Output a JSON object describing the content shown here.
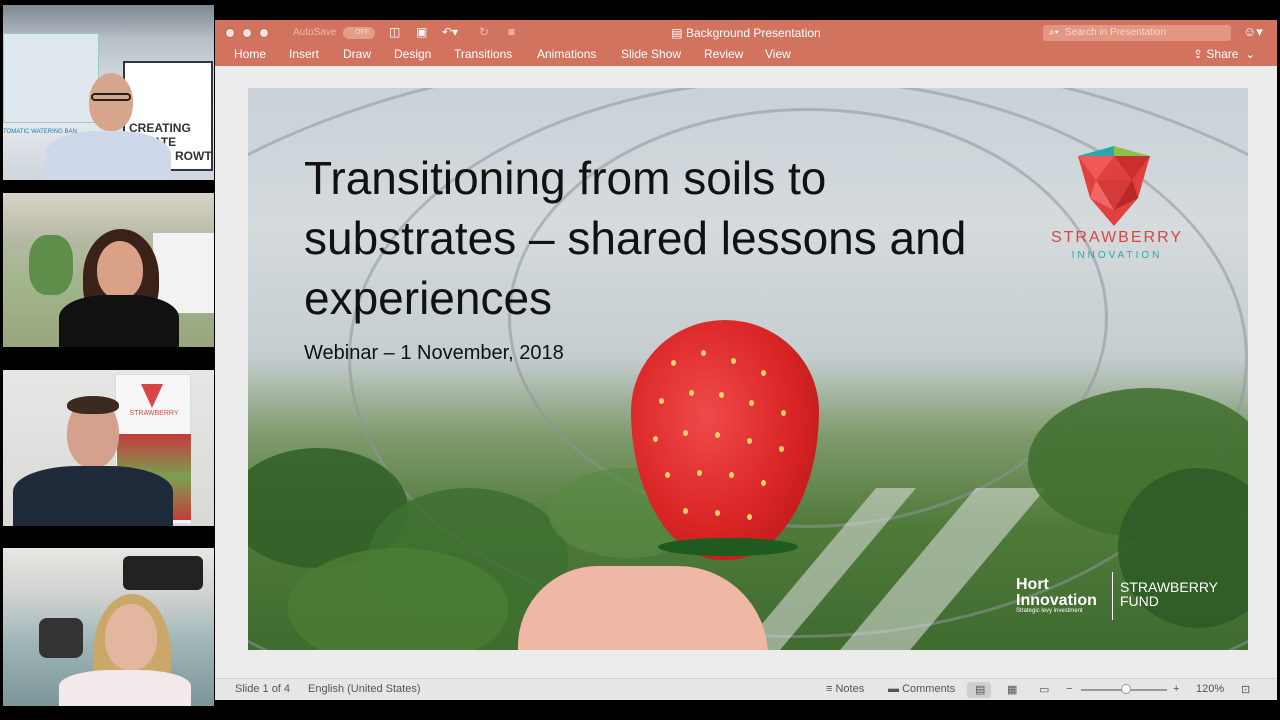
{
  "app": {
    "title": "Background Presentation",
    "autosave_label": "AutoSave",
    "autosave_state": "OFF",
    "search_placeholder": "Search in Presentation",
    "share_label": "Share"
  },
  "ribbon": {
    "tabs": [
      "Home",
      "Insert",
      "Draw",
      "Design",
      "Transitions",
      "Animations",
      "Slide Show",
      "Review",
      "View"
    ]
  },
  "slide": {
    "title": "Transitioning from soils to substrates – shared lessons and experiences",
    "subtitle": "Webinar – 1 November, 2018",
    "logo_name": "STRAWBERRY",
    "logo_sub": "INNOVATION",
    "hort_line1": "Hort",
    "hort_line2": "Innovation",
    "hort_tagline": "Strategic levy investment",
    "fund_line1": "STRAWBERRY",
    "fund_line2": "FUND"
  },
  "video_tiles": [
    {
      "name": "participant-1",
      "banner_text_1": "CREATING",
      "banner_text_2": "MATE",
      "banner_text_3": "ROWT",
      "banner_small": "TOMATIC WATERING BAN"
    },
    {
      "name": "participant-2"
    },
    {
      "name": "participant-3",
      "banner_text": "STRAWBERRY"
    },
    {
      "name": "participant-4"
    }
  ],
  "status": {
    "slide_counter": "Slide 1 of 4",
    "language": "English (United States)",
    "notes_label": "Notes",
    "comments_label": "Comments",
    "zoom": "120%"
  },
  "icons": {
    "accent": "#d2735f",
    "brand_red": "#d94545",
    "brand_teal": "#2aa8a8"
  }
}
